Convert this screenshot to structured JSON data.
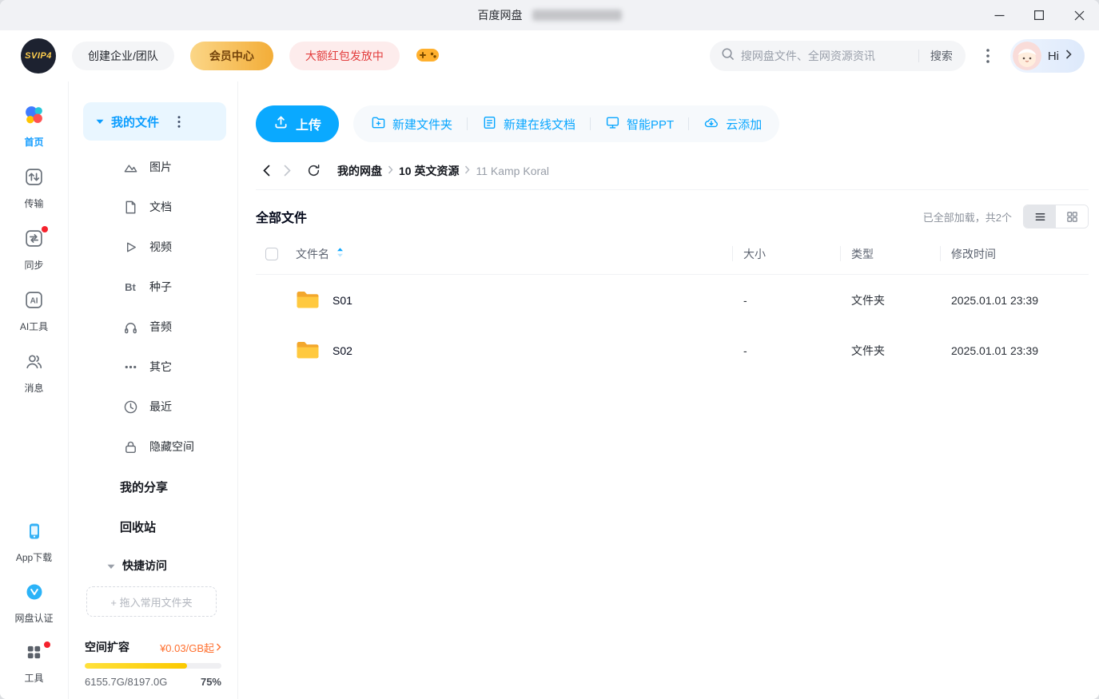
{
  "titlebar": {
    "title": "百度网盘"
  },
  "header": {
    "logo_text": "SVIP4",
    "create_team": "创建企业/团队",
    "member_center": "会员中心",
    "red_packet": "大额红包发放中",
    "search_placeholder": "搜网盘文件、全网资源资讯",
    "search_button": "搜索",
    "greeting": "Hi"
  },
  "nav": {
    "ai_icon_text": "AI",
    "items": [
      {
        "label": "首页"
      },
      {
        "label": "传输"
      },
      {
        "label": "同步"
      },
      {
        "label": "AI工具"
      },
      {
        "label": "消息"
      }
    ],
    "bottom_items": [
      {
        "label": "App下载"
      },
      {
        "label": "网盘认证"
      },
      {
        "label": "工具"
      }
    ]
  },
  "sidebar": {
    "my_files_label": "我的文件",
    "bt_icon_text": "Bt",
    "categories": [
      {
        "label": "图片"
      },
      {
        "label": "文档"
      },
      {
        "label": "视频"
      },
      {
        "label": "种子"
      },
      {
        "label": "音频"
      },
      {
        "label": "其它"
      },
      {
        "label": "最近"
      },
      {
        "label": "隐藏空间"
      }
    ],
    "my_share": "我的分享",
    "recycle_bin": "回收站",
    "quick_access": "快捷访问",
    "drag_hint": "+ 拖入常用文件夹",
    "storage": {
      "expand_label": "空间扩容",
      "price": "¥0.03/GB起",
      "usage": "6155.7G/8197.0G",
      "percent": "75%",
      "progress_style": "width:75%"
    }
  },
  "toolbar": {
    "upload": "上传",
    "actions": [
      {
        "label": "新建文件夹"
      },
      {
        "label": "新建在线文档"
      },
      {
        "label": "智能PPT"
      },
      {
        "label": "云添加"
      }
    ]
  },
  "breadcrumb": {
    "items": [
      {
        "label": "我的网盘"
      },
      {
        "label": "10 英文资源"
      },
      {
        "label": "11 Kamp Koral"
      }
    ]
  },
  "files": {
    "section_title": "全部文件",
    "load_status": "已全部加载，共2个",
    "columns": {
      "name": "文件名",
      "size": "大小",
      "type": "类型",
      "modified": "修改时间"
    },
    "rows": [
      {
        "name": "S01",
        "size": "-",
        "type": "文件夹",
        "modified": "2025.01.01 23:39"
      },
      {
        "name": "S02",
        "size": "-",
        "type": "文件夹",
        "modified": "2025.01.01 23:39"
      }
    ]
  },
  "colors": {
    "primary": "#06a7ff",
    "folder_yellow": "#ffc62e",
    "progress_yellow": "#ffd60a",
    "badge_red": "#f5222d"
  }
}
